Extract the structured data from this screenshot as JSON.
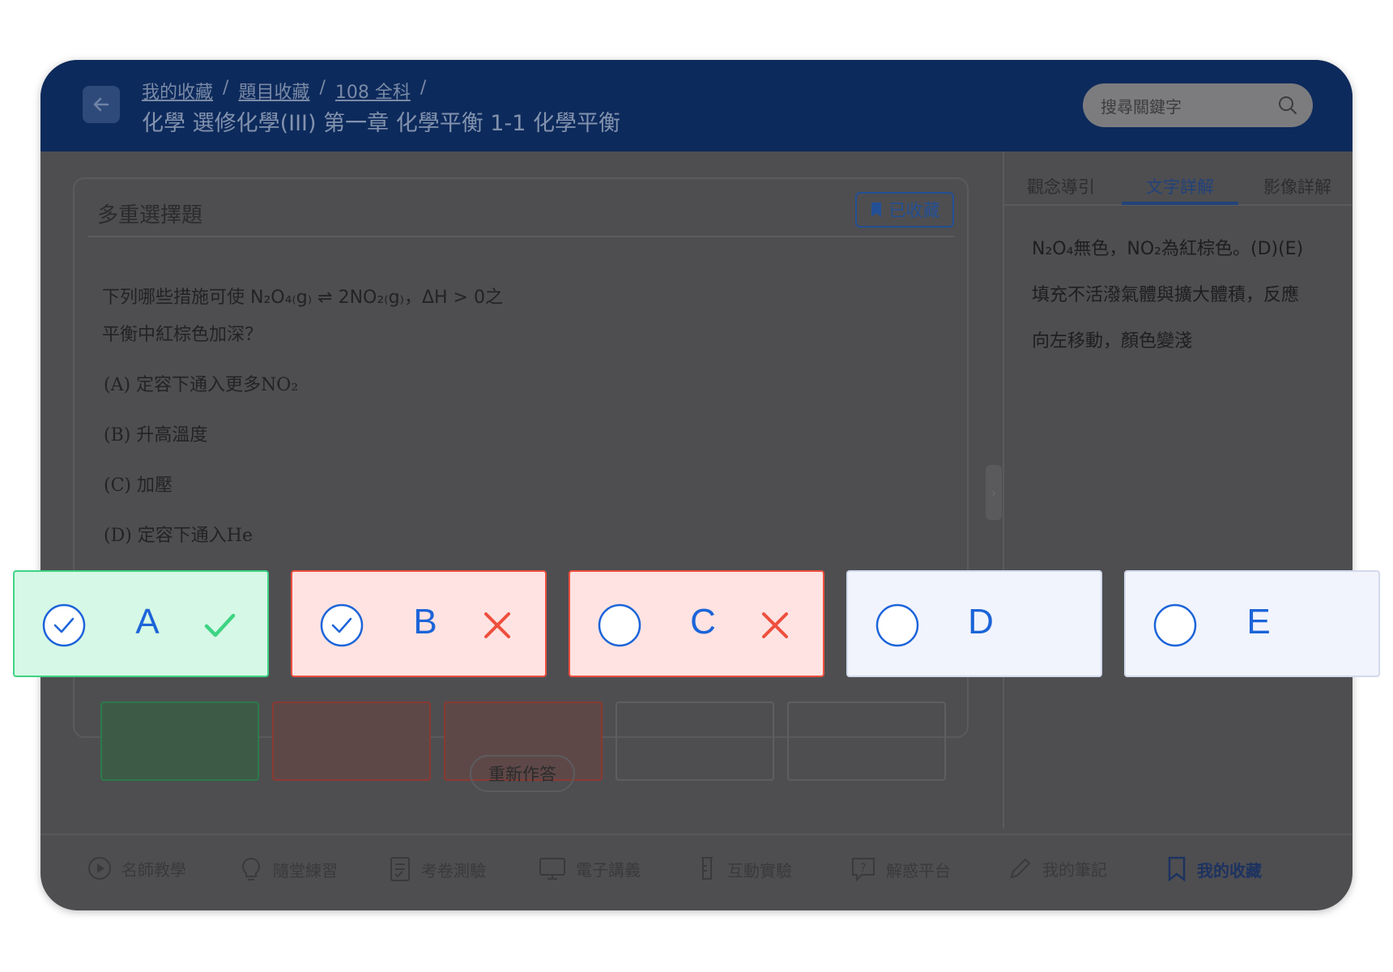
{
  "header": {
    "breadcrumbs": [
      "我的收藏",
      "題目收藏",
      "108 全科"
    ],
    "title": "化學 選修化學(III) 第一章 化學平衡 1-1 化學平衡",
    "search_placeholder": "搜尋關鍵字"
  },
  "question_card": {
    "type_label": "多重選擇題",
    "favorite_label": "已收藏",
    "question_line1": "下列哪些措施可使 N₂O₄₍g₎ ⇌ 2NO₂₍g₎，ΔH > 0之",
    "question_line2": "平衡中紅棕色加深？",
    "options": [
      "(A) 定容下通入更多NO₂",
      "(B) 升高溫度",
      "(C) 加壓",
      "(D) 定容下通入He"
    ],
    "retry_label": "重新作答"
  },
  "side_panel": {
    "tabs": [
      "觀念導引",
      "文字詳解",
      "影像詳解"
    ],
    "active_tab": "文字詳解",
    "explanation_lines": [
      "N₂O₄無色，NO₂為紅棕色。(D)(E)",
      "填充不活潑氣體與擴大體積，反應",
      "向左移動，顏色變淺"
    ]
  },
  "bottom_nav": [
    {
      "label": "名師教學",
      "icon": "play-circle-icon"
    },
    {
      "label": "隨堂練習",
      "icon": "lightbulb-icon"
    },
    {
      "label": "考卷測驗",
      "icon": "exam-paper-icon"
    },
    {
      "label": "電子講義",
      "icon": "monitor-icon"
    },
    {
      "label": "互動實驗",
      "icon": "beaker-icon"
    },
    {
      "label": "解惑平台",
      "icon": "question-bubble-icon"
    },
    {
      "label": "我的筆記",
      "icon": "pencil-icon"
    },
    {
      "label": "我的收藏",
      "icon": "bookmark-icon"
    }
  ],
  "answer_choices": [
    {
      "letter": "A",
      "selected": true,
      "state": "correct"
    },
    {
      "letter": "B",
      "selected": true,
      "state": "wrong"
    },
    {
      "letter": "C",
      "selected": false,
      "state": "wrong"
    },
    {
      "letter": "D",
      "selected": false,
      "state": "neutral"
    },
    {
      "letter": "E",
      "selected": false,
      "state": "neutral"
    }
  ],
  "colors": {
    "header_bg": "#0d2a5c",
    "accent_blue": "#1c64d9",
    "correct_green": "#3dd483",
    "wrong_red": "#ef4f3d"
  }
}
